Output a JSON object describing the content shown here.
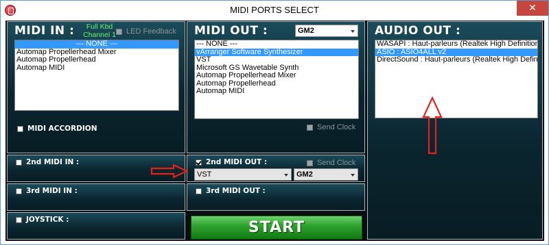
{
  "window": {
    "title": "MIDI PORTS SELECT",
    "close_glyph": "✕"
  },
  "midi_in": {
    "title": "MIDI IN :",
    "full_kbd": [
      "Full Kbd",
      "Channel 1"
    ],
    "led_feedback": "LED Feedback",
    "items": [
      "--- NONE ---",
      "Automap Propellerhead Mixer",
      "Automap Propellerhead",
      "Automap MIDI"
    ],
    "selected_index": 0,
    "midi_accordion": "MIDI ACCORDION"
  },
  "midi_out": {
    "title": "MIDI OUT :",
    "mode": "GM2",
    "items": [
      "--- NONE ---",
      "vArranger Software Synthesizer",
      "VST",
      "Microsoft GS Wavetable Synth",
      "Automap Propellerhead Mixer",
      "Automap Propellerhead",
      "Automap MIDI"
    ],
    "selected_index": 1,
    "send_clock": "Send Clock"
  },
  "audio_out": {
    "title": "AUDIO OUT :",
    "items": [
      "WASAPI : Haut-parleurs (Realtek High Definition Audio)",
      "ASIO : ASIO4ALL v2",
      "DirectSound : Haut-parleurs (Realtek High Definition Audio)"
    ],
    "selected_index": 1
  },
  "second_midi_in": {
    "label": "2nd MIDI IN :",
    "checked": false
  },
  "second_midi_out": {
    "label": "2nd MIDI OUT :",
    "checked": true,
    "send_clock": "Send Clock",
    "port": "VST",
    "mode": "GM2"
  },
  "third_midi_in": {
    "label": "3rd MIDI IN :",
    "checked": false
  },
  "third_midi_out": {
    "label": "3rd MIDI OUT :",
    "checked": false
  },
  "joystick": {
    "label": "JOYSTICK :",
    "checked": false
  },
  "start_label": "START",
  "colors": {
    "panel_top": "#1a4b5a",
    "panel_bottom": "#081c23",
    "selection": "#3399ff",
    "start_green": "#2fa32f",
    "annotation_red": "#e8201a",
    "full_kbd_green": "#6ef06e"
  },
  "annotations": [
    "red-arrow-right",
    "red-arrow-up"
  ]
}
